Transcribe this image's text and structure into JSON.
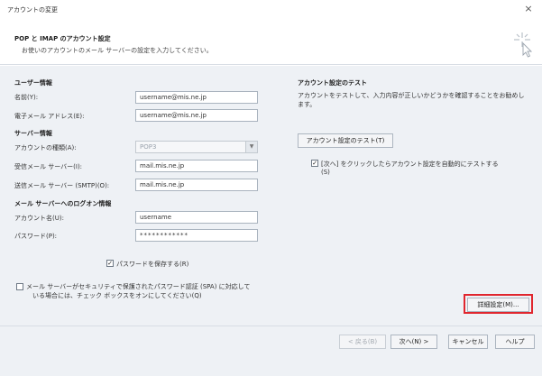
{
  "window": {
    "title": "アカウントの変更",
    "close_glyph": "×"
  },
  "header": {
    "title": "POP と IMAP のアカウント設定",
    "subtitle": "お使いのアカウントのメール サーバーの設定を入力してください。",
    "icon": "cursor-sparkle-icon"
  },
  "user_info": {
    "section_label": "ユーザー情報",
    "name_label": "名前(Y):",
    "name_value": "username@mis.ne.jp",
    "email_label": "電子メール アドレス(E):",
    "email_value": "username@mis.ne.jp"
  },
  "server_info": {
    "section_label": "サーバー情報",
    "account_type_label": "アカウントの種類(A):",
    "account_type_value": "POP3",
    "incoming_label": "受信メール サーバー(I):",
    "incoming_value": "mail.mis.ne.jp",
    "outgoing_label": "送信メール サーバー (SMTP)(O):",
    "outgoing_value": "mail.mis.ne.jp"
  },
  "logon_info": {
    "section_label": "メール サーバーへのログオン情報",
    "account_name_label": "アカウント名(U):",
    "account_name_value": "username",
    "password_label": "パスワード(P):",
    "password_value": "************",
    "remember_password_label": "パスワードを保存する(R)",
    "remember_password_checked": true
  },
  "spa": {
    "label_line1": "メール サーバーがセキュリティで保護されたパスワード認証 (SPA) に対応して",
    "label_line2": "いる場合には、チェック ボックスをオンにしてください(Q)",
    "checked": false
  },
  "test": {
    "section_label": "アカウント設定のテスト",
    "description": "アカウントをテストして、入力内容が正しいかどうかを確認することをお勧めします。",
    "test_button": "アカウント設定のテスト(T)",
    "auto_test_label_line1": "[次へ] をクリックしたらアカウント設定を自動的にテストする",
    "auto_test_label_line2": "(S)",
    "auto_test_checked": true
  },
  "more_settings_button": "詳細設定(M)...",
  "footer": {
    "back_button": "< 戻る(B)",
    "next_button": "次へ(N) >",
    "cancel_button": "キャンセル",
    "help_button": "ヘルプ"
  },
  "colors": {
    "highlight": "#e0262e",
    "panel_bg": "#eef1f5"
  }
}
